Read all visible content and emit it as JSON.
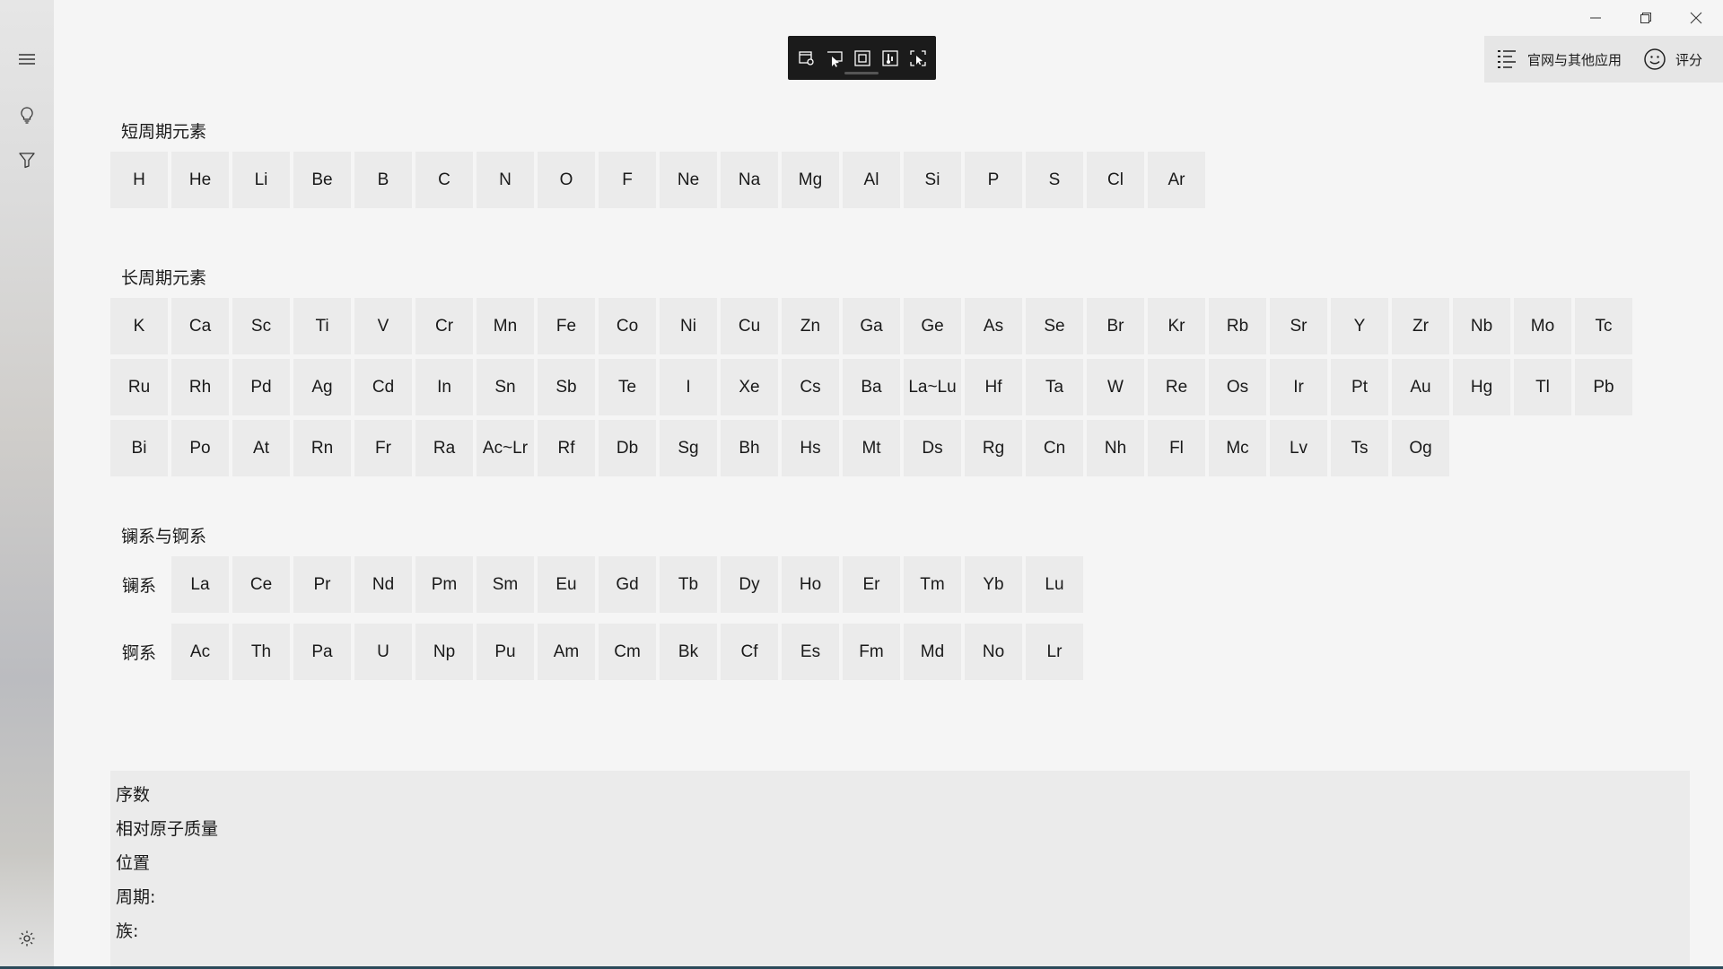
{
  "window_controls": {
    "minimize_icon": "minimize-icon",
    "restore_icon": "restore-icon",
    "close_icon": "close-icon"
  },
  "sidebar": {
    "items": [
      "menu-icon",
      "lightbulb-icon",
      "filter-icon",
      "gear-icon"
    ]
  },
  "toolbar": {
    "icons": [
      "settings-window-icon",
      "pointer-icon",
      "frame-icon",
      "thermometer-icon",
      "expand-icon"
    ]
  },
  "top_right": {
    "apps_label": "官网与其他应用",
    "rate_label": "评分"
  },
  "short_period": {
    "title": "短周期元素",
    "elements": [
      "H",
      "He",
      "Li",
      "Be",
      "B",
      "C",
      "N",
      "O",
      "F",
      "Ne",
      "Na",
      "Mg",
      "Al",
      "Si",
      "P",
      "S",
      "Cl",
      "Ar"
    ]
  },
  "long_period": {
    "title": "长周期元素",
    "rows": [
      [
        "K",
        "Ca",
        "Sc",
        "Ti",
        "V",
        "Cr",
        "Mn",
        "Fe",
        "Co",
        "Ni",
        "Cu",
        "Zn",
        "Ga",
        "Ge",
        "As",
        "Se",
        "Br",
        "Kr",
        "Rb",
        "Sr",
        "Y",
        "Zr",
        "Nb",
        "Mo",
        "Tc"
      ],
      [
        "Ru",
        "Rh",
        "Pd",
        "Ag",
        "Cd",
        "In",
        "Sn",
        "Sb",
        "Te",
        "I",
        "Xe",
        "Cs",
        "Ba",
        "La~Lu",
        "Hf",
        "Ta",
        "W",
        "Re",
        "Os",
        "Ir",
        "Pt",
        "Au",
        "Hg",
        "Tl",
        "Pb"
      ],
      [
        "Bi",
        "Po",
        "At",
        "Rn",
        "Fr",
        "Ra",
        "Ac~Lr",
        "Rf",
        "Db",
        "Sg",
        "Bh",
        "Hs",
        "Mt",
        "Ds",
        "Rg",
        "Cn",
        "Nh",
        "Fl",
        "Mc",
        "Lv",
        "Ts",
        "Og"
      ]
    ]
  },
  "lan_act": {
    "title": "镧系与锕系",
    "lanthanide_label": "镧系",
    "lanthanides": [
      "La",
      "Ce",
      "Pr",
      "Nd",
      "Pm",
      "Sm",
      "Eu",
      "Gd",
      "Tb",
      "Dy",
      "Ho",
      "Er",
      "Tm",
      "Yb",
      "Lu"
    ],
    "actinide_label": "锕系",
    "actinides": [
      "Ac",
      "Th",
      "Pa",
      "U",
      "Np",
      "Pu",
      "Am",
      "Cm",
      "Bk",
      "Cf",
      "Es",
      "Fm",
      "Md",
      "No",
      "Lr"
    ]
  },
  "info": {
    "number_label": "序数",
    "mass_label": "相对原子质量",
    "position_label": "位置",
    "period_label": "周期:",
    "group_label": "族:"
  }
}
